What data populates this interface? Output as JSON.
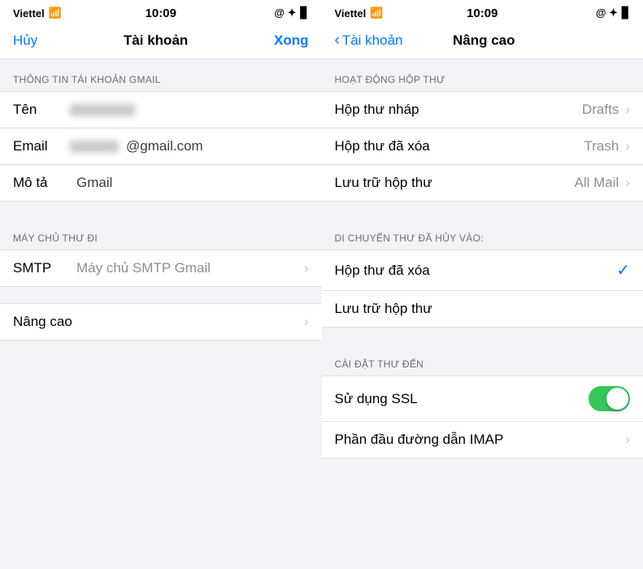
{
  "panel_left": {
    "status": {
      "carrier": "Viettel",
      "time": "10:09",
      "icons_right": "@ ✦ 🔋"
    },
    "nav": {
      "cancel_label": "Hủy",
      "title": "Tài khoản",
      "done_label": "Xong"
    },
    "section1": {
      "header": "THÔNG TIN TÀI KHOẢN GMAIL",
      "rows": [
        {
          "label": "Tên",
          "value": "",
          "blurred_name": true
        },
        {
          "label": "Email",
          "value_prefix": "",
          "value_suffix": "@gmail.com",
          "blurred_email": true
        },
        {
          "label": "Mô tả",
          "value": "Gmail"
        }
      ]
    },
    "section2": {
      "header": "MÁY CHỦ THƯ ĐI",
      "rows": [
        {
          "label": "SMTP",
          "value": "Máy chủ SMTP Gmail",
          "has_chevron": true
        }
      ]
    },
    "section3": {
      "rows": [
        {
          "label": "Nâng cao",
          "has_chevron": true
        }
      ]
    }
  },
  "panel_right": {
    "status": {
      "carrier": "Viettel",
      "time": "10:09",
      "icons_right": "@ ✦ 🔋"
    },
    "nav": {
      "back_label": "Tài khoản",
      "title": "Nâng cao"
    },
    "section1": {
      "header": "HOẠT ĐỘNG HỘP THƯ",
      "rows": [
        {
          "label": "Hộp thư nháp",
          "value": "Drafts",
          "has_chevron": true
        },
        {
          "label": "Hộp thư đã xóa",
          "value": "Trash",
          "has_chevron": true
        },
        {
          "label": "Lưu trữ hộp thư",
          "value": "All Mail",
          "has_chevron": true
        }
      ]
    },
    "section2": {
      "header": "DI CHUYỂN THƯ ĐÃ HỦY VÀO:",
      "rows": [
        {
          "label": "Hộp thư đã xóa",
          "checked": true
        },
        {
          "label": "Lưu trữ hộp thư",
          "checked": false
        }
      ]
    },
    "section3": {
      "header": "CÀI ĐẶT THƯ ĐẾN",
      "rows": [
        {
          "label": "Sử dụng SSL",
          "toggle": true
        },
        {
          "label": "Phần đầu đường dẫn IMAP",
          "has_chevron": true
        }
      ]
    }
  }
}
